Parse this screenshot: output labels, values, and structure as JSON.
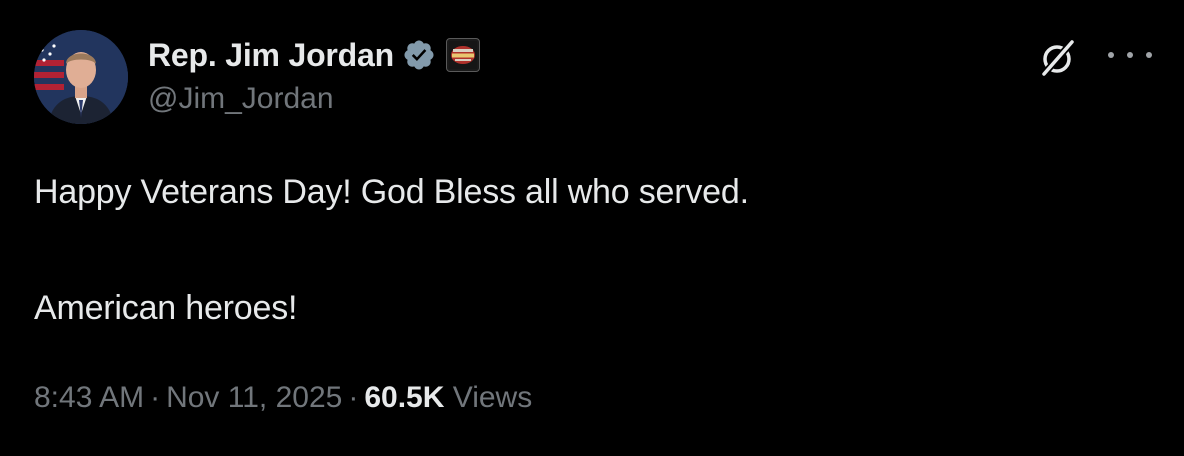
{
  "author": {
    "display_name": "Rep. Jim Jordan",
    "handle": "@Jim_Jordan",
    "verified_icon": "verified-badge-icon",
    "affiliation_icon": "affiliation-badge-icon",
    "avatar_icon": "avatar"
  },
  "toolbar": {
    "grok_icon": "grok-icon",
    "more_icon": "more-options-icon"
  },
  "tweet": {
    "line1": "Happy Veterans Day! God Bless all who served.",
    "line2": "American heroes!"
  },
  "meta": {
    "time": "8:43 AM",
    "separator": "·",
    "date": "Nov 11, 2025",
    "views_count": "60.5K",
    "views_label": "Views"
  },
  "colors": {
    "background": "#000000",
    "primary_text": "#e7e9ea",
    "secondary_text": "#71767b",
    "verified_badge": "#829aab"
  }
}
